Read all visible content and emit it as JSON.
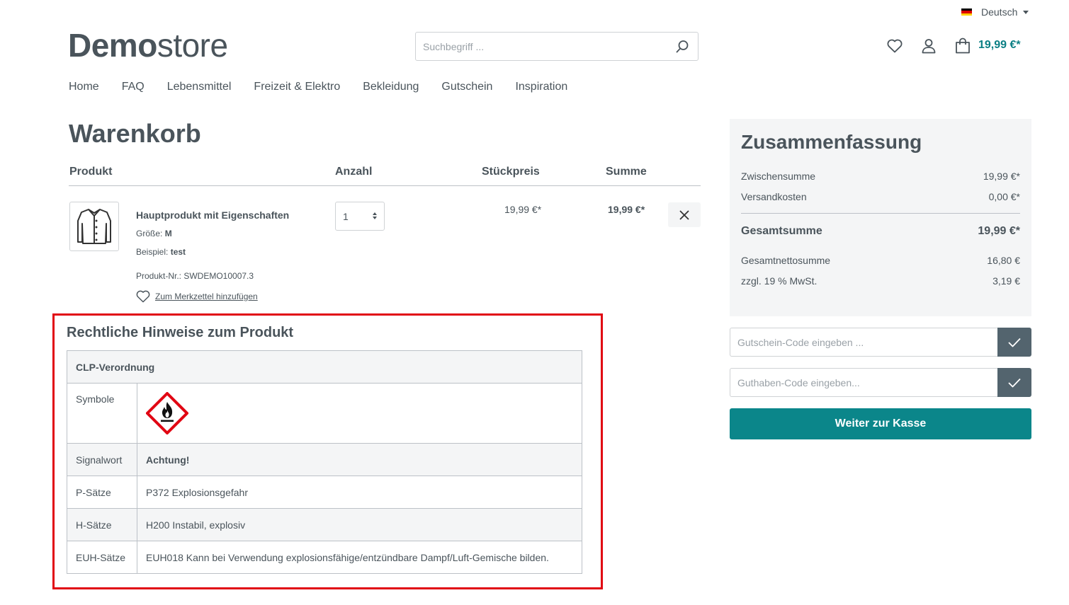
{
  "language": {
    "label": "Deutsch",
    "flag_colors": [
      "#000000",
      "#dd0000",
      "#ffce00"
    ]
  },
  "logo": {
    "bold": "Demo",
    "light": "store"
  },
  "search": {
    "placeholder": "Suchbegriff ..."
  },
  "header": {
    "cart_total": "19,99 €*"
  },
  "nav": [
    "Home",
    "FAQ",
    "Lebensmittel",
    "Freizeit & Elektro",
    "Bekleidung",
    "Gutschein",
    "Inspiration"
  ],
  "page_title": "Warenkorb",
  "cart_headers": {
    "product": "Produkt",
    "quantity": "Anzahl",
    "unit_price": "Stückpreis",
    "total": "Summe"
  },
  "item": {
    "name": "Hauptprodukt mit Eigenschaften",
    "props": [
      {
        "label": "Größe:",
        "value": "M"
      },
      {
        "label": "Beispiel:",
        "value": "test"
      }
    ],
    "product_no": "Produkt-Nr.: SWDEMO10007.3",
    "wishlist": "Zum Merkzettel hinzufügen",
    "quantity": "1",
    "unit_price": "19,99 €*",
    "total": "19,99 €*"
  },
  "legal": {
    "title": "Rechtliche Hinweise zum Produkt",
    "table_header": "CLP-Verordnung",
    "rows": [
      {
        "key": "Symbole",
        "value": ""
      },
      {
        "key": "Signalwort",
        "value": "Achtung!"
      },
      {
        "key": "P-Sätze",
        "value": "P372 Explosionsgefahr"
      },
      {
        "key": "H-Sätze",
        "value": "H200 Instabil, explosiv"
      },
      {
        "key": "EUH-Sätze",
        "value": "EUH018 Kann bei Verwendung explosionsfähige/entzündbare Dampf/Luft-Gemische bilden."
      }
    ],
    "symbol_icon": "flammable-ghs-icon"
  },
  "summary": {
    "title": "Zusammenfassung",
    "subtotal_label": "Zwischensumme",
    "subtotal": "19,99 €*",
    "shipping_label": "Versandkosten",
    "shipping": "0,00 €*",
    "total_label": "Gesamtsumme",
    "total": "19,99 €*",
    "net_label": "Gesamtnettosumme",
    "net": "16,80 €",
    "tax_label": "zzgl. 19 % MwSt.",
    "tax": "3,19 €"
  },
  "voucher": {
    "placeholder": "Gutschein-Code eingeben ..."
  },
  "credit": {
    "placeholder": "Guthaben-Code eingeben..."
  },
  "checkout_label": "Weiter zur Kasse",
  "colors": {
    "accent": "#0b868a",
    "price": "#0b7f84",
    "highlight": "#e10613",
    "confirm": "#53646e"
  }
}
